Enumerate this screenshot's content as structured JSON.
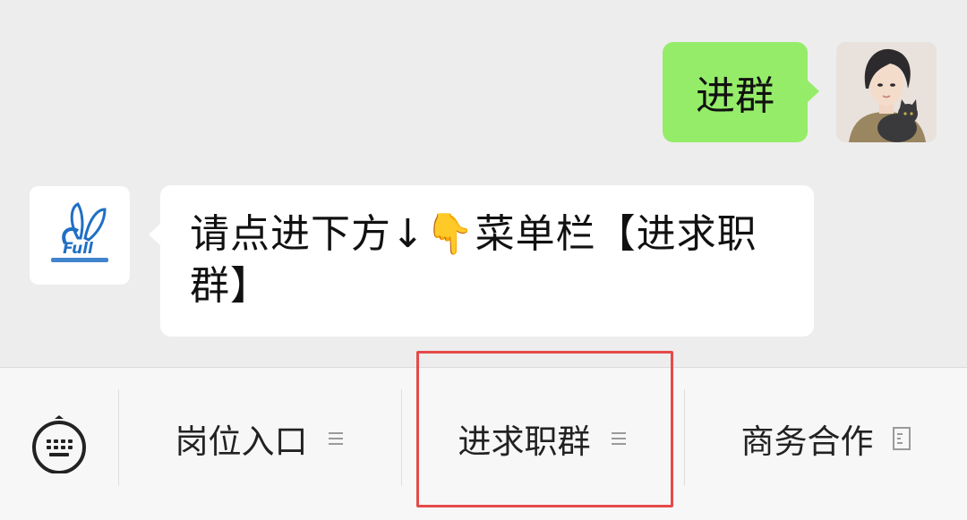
{
  "chat": {
    "outgoing": {
      "text": "进群"
    },
    "incoming": {
      "text_before_emoji": "请点进下方↓",
      "emoji": "👇",
      "text_after_emoji": "菜单栏【进求职群】"
    }
  },
  "menu": {
    "keyboard_icon": "keyboard-icon",
    "items": [
      {
        "label": "岗位入口",
        "icon": "menu-lines-icon"
      },
      {
        "label": "进求职群",
        "icon": "menu-lines-icon"
      },
      {
        "label": "商务合作",
        "icon": "document-icon"
      }
    ],
    "highlighted_index": 1
  },
  "colors": {
    "chat_bg": "#ededed",
    "outgoing_bubble": "#95ec69",
    "incoming_bubble": "#ffffff",
    "menu_bg": "#f7f7f7",
    "highlight_border": "#e54a4a",
    "logo_blue": "#1f6fc4"
  }
}
